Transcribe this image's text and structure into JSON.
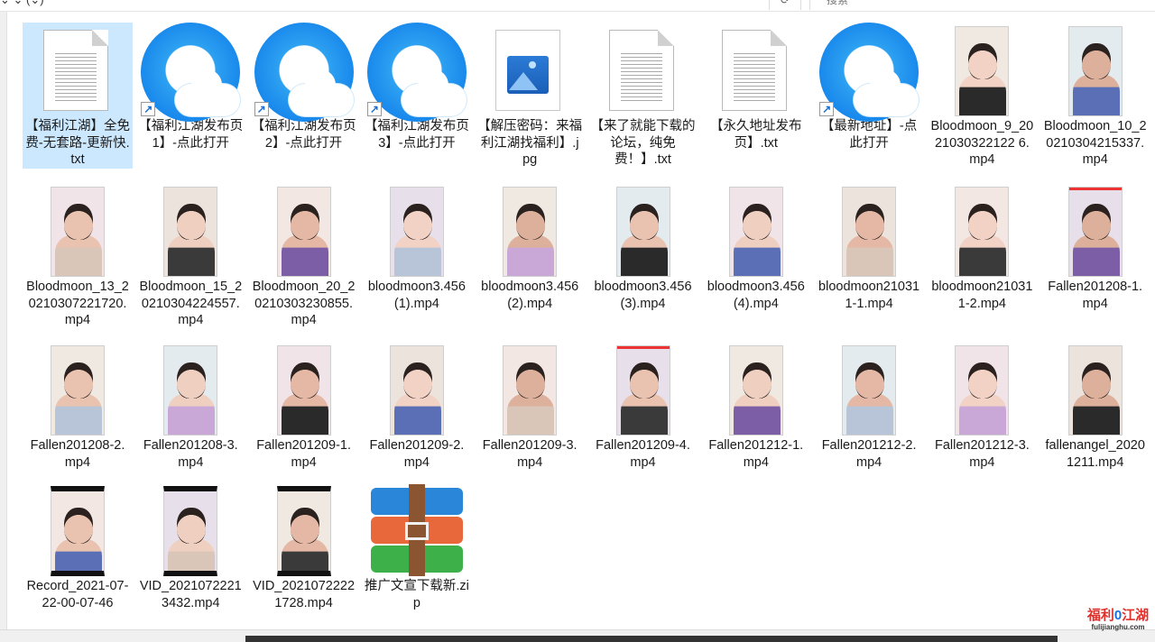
{
  "toolbar": {
    "path": "     ⌄   ⌄  (⌄)",
    "refresh": "⟳",
    "search_placeholder": "搜索"
  },
  "files": [
    {
      "label": "【福利江湖】全免费-无套路-更新快.txt",
      "icon": "txt",
      "selected": true
    },
    {
      "label": "【福利江湖发布页1】-点此打开",
      "icon": "qq-shortcut"
    },
    {
      "label": "【福利江湖发布页2】-点此打开",
      "icon": "qq-shortcut"
    },
    {
      "label": "【福利江湖发布页3】-点此打开",
      "icon": "qq-shortcut"
    },
    {
      "label": "【解压密码：来福利江湖找福利】.jpg",
      "icon": "jpg"
    },
    {
      "label": "【来了就能下载的论坛，纯免费！】.txt",
      "icon": "txt"
    },
    {
      "label": "【永久地址发布页】.txt",
      "icon": "txt"
    },
    {
      "label": "【最新地址】-点此打开",
      "icon": "qq-shortcut"
    },
    {
      "label": "Bloodmoon_9_2021030322122 6.mp4",
      "icon": "video"
    },
    {
      "label": "Bloodmoon_10_20210304215337.mp4",
      "icon": "video"
    },
    {
      "label": "Bloodmoon_13_20210307221720.mp4",
      "icon": "video"
    },
    {
      "label": "Bloodmoon_15_20210304224557.mp4",
      "icon": "video"
    },
    {
      "label": "Bloodmoon_20_20210303230855.mp4",
      "icon": "video"
    },
    {
      "label": "bloodmoon3.456 (1).mp4",
      "icon": "video"
    },
    {
      "label": "bloodmoon3.456 (2).mp4",
      "icon": "video"
    },
    {
      "label": "bloodmoon3.456 (3).mp4",
      "icon": "video"
    },
    {
      "label": "bloodmoon3.456 (4).mp4",
      "icon": "video"
    },
    {
      "label": "bloodmoon210311-1.mp4",
      "icon": "video"
    },
    {
      "label": "bloodmoon210311-2.mp4",
      "icon": "video"
    },
    {
      "label": "Fallen201208-1.mp4",
      "icon": "video"
    },
    {
      "label": "Fallen201208-2.mp4",
      "icon": "video"
    },
    {
      "label": "Fallen201208-3.mp4",
      "icon": "video"
    },
    {
      "label": "Fallen201209-1.mp4",
      "icon": "video"
    },
    {
      "label": "Fallen201209-2.mp4",
      "icon": "video"
    },
    {
      "label": "Fallen201209-3.mp4",
      "icon": "video"
    },
    {
      "label": "Fallen201209-4.mp4",
      "icon": "video"
    },
    {
      "label": "Fallen201212-1.mp4",
      "icon": "video"
    },
    {
      "label": "Fallen201212-2.mp4",
      "icon": "video"
    },
    {
      "label": "Fallen201212-3.mp4",
      "icon": "video"
    },
    {
      "label": "fallenangel_20201211.mp4",
      "icon": "video"
    },
    {
      "label": "Record_2021-07-22-00-07-46",
      "icon": "video"
    },
    {
      "label": "VID_2021072221 3432.mp4",
      "icon": "video"
    },
    {
      "label": "VID_2021072222 1728.mp4",
      "icon": "video"
    },
    {
      "label": "推广文宣下载新.zip",
      "icon": "zip"
    }
  ],
  "watermark": {
    "brand_red1": "福利",
    "brand_blue": "0",
    "brand_red2": "江湖",
    "domain": "fulijianghu.com"
  },
  "colors": {
    "selection": "#cce8ff",
    "qq_blue": "#1989ec"
  }
}
